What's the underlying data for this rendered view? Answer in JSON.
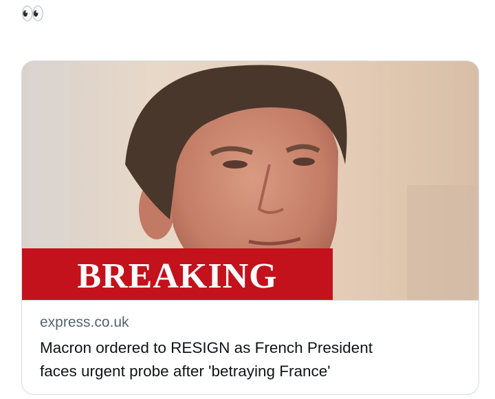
{
  "tweet": {
    "text": "👀"
  },
  "card": {
    "banner_label": "BREAKING",
    "domain": "express.co.uk",
    "title_line1": "Macron ordered to RESIGN as French President",
    "title_line2": "faces urgent probe after 'betraying France'"
  },
  "colors": {
    "banner": "#c3121c",
    "domain": "#536471",
    "title": "#0f1419",
    "border": "#d5dadf"
  }
}
